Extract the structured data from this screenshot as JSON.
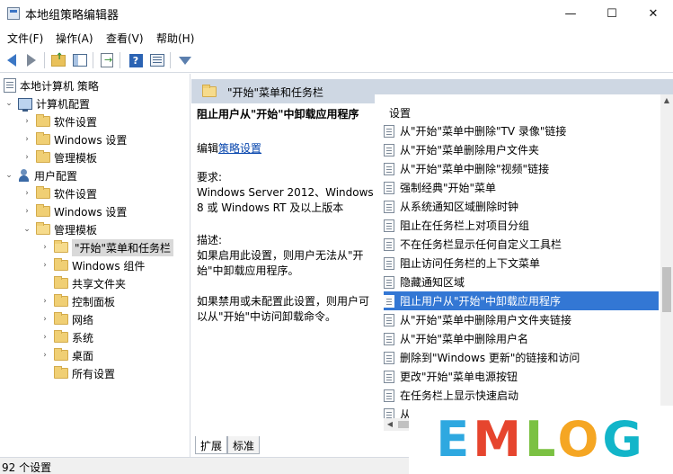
{
  "window": {
    "title": "本地组策略编辑器",
    "minimize_glyph": "—",
    "maximize_glyph": "☐",
    "close_glyph": "✕"
  },
  "menu": [
    "文件(F)",
    "操作(A)",
    "查看(V)",
    "帮助(H)"
  ],
  "toolbar": {
    "icons": [
      "back-icon",
      "forward-icon",
      "up-folder-icon",
      "show-pane-icon",
      "export-icon",
      "help-icon",
      "properties-icon",
      "filter-icon"
    ],
    "help_glyph": "?"
  },
  "tree": {
    "root": "本地计算机 策略",
    "computer_config": "计算机配置",
    "cc_software": "软件设置",
    "cc_windows": "Windows 设置",
    "cc_admin": "管理模板",
    "user_config": "用户配置",
    "uc_software": "软件设置",
    "uc_windows": "Windows 设置",
    "uc_admin": "管理模板",
    "start_taskbar": "\"开始\"菜单和任务栏",
    "windows_components": "Windows 组件",
    "shared_folders": "共享文件夹",
    "control_panel": "控制面板",
    "network": "网络",
    "system": "系统",
    "desktop": "桌面",
    "all_settings": "所有设置",
    "chevron_open": "⌄",
    "chevron_closed": "›"
  },
  "right_pane": {
    "header_title": "\"开始\"菜单和任务栏",
    "description": {
      "title": "阻止用户从\"开始\"中卸载应用程序",
      "edit_prefix": "编辑",
      "edit_link": "策略设置",
      "requirements_label": "要求:",
      "requirements": "Windows Server 2012、Windows 8 或 Windows RT 及以上版本",
      "description_label": "描述:",
      "description": "如果启用此设置，则用户无法从\"开始\"中卸载应用程序。",
      "description2": "如果禁用或未配置此设置，则用户可以从\"开始\"中访问卸载命令。"
    },
    "list_header": "设置",
    "settings": [
      "从\"开始\"菜单中删除\"TV 录像\"链接",
      "从\"开始\"菜单删除用户文件夹",
      "从\"开始\"菜单中删除\"视频\"链接",
      "强制经典\"开始\"菜单",
      "从系统通知区域删除时钟",
      "阻止在任务栏上对项目分组",
      "不在任务栏显示任何自定义工具栏",
      "阻止访问任务栏的上下文菜单",
      "隐藏通知区域",
      "阻止用户从\"开始\"中卸载应用程序",
      "从\"开始\"菜单中删除用户文件夹链接",
      "从\"开始\"菜单中删除用户名",
      "删除到\"Windows 更新\"的链接和访问",
      "更改\"开始\"菜单电源按钮",
      "在任务栏上显示快速启动",
      "从\"开始\"菜单中删除\"移动 PC\"链接"
    ],
    "selected_setting": "阻止用户从\"开始\"中卸载应用程序",
    "tabs": [
      "扩展",
      "标准"
    ],
    "scroll_up_glyph": "▲",
    "scroll_left_glyph": "◀"
  },
  "status": {
    "text": "92 个设置"
  },
  "watermark": {
    "text": "EMLOG",
    "colors": [
      "#2ea8e0",
      "#e6452e",
      "#7bc142",
      "#f5a623",
      "#12b5c9"
    ]
  }
}
